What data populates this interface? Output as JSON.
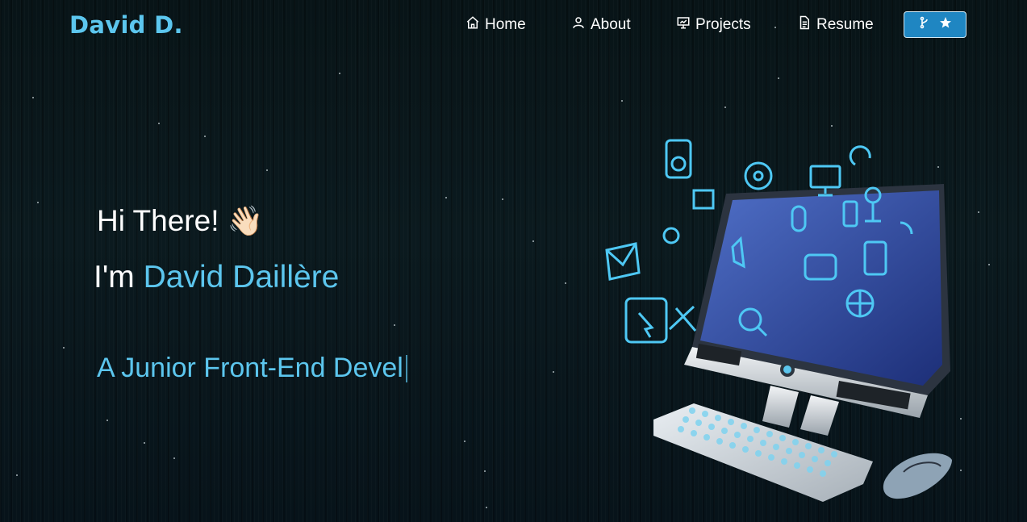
{
  "brand": "David D.",
  "nav": {
    "home": "Home",
    "about": "About",
    "projects": "Projects",
    "resume": "Resume"
  },
  "github_button": {
    "icons": [
      "fork-icon",
      "star-icon"
    ]
  },
  "hero": {
    "greeting": "Hi There!",
    "greeting_emoji": "👋🏻",
    "intro_prefix": "I'm ",
    "name": "David Daillère",
    "typed_text": "A Junior Front-End Devel"
  },
  "colors": {
    "accent": "#5cc6ee",
    "button": "#1f86c2",
    "background": "#0b1a1f"
  }
}
